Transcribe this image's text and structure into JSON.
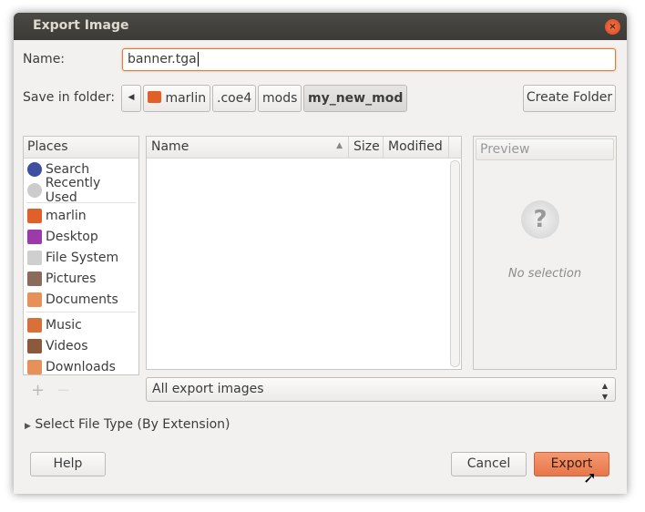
{
  "window": {
    "title": "Export Image"
  },
  "name_label": "Name:",
  "name_value": "banner.tga",
  "folder_label": "Save in folder:",
  "breadcrumbs": [
    "marlin",
    ".coe4",
    "mods",
    "my_new_mod"
  ],
  "create_folder": "Create Folder",
  "places": {
    "header": "Places",
    "items": [
      {
        "label": "Search",
        "color": "#3c4fa0"
      },
      {
        "label": "Recently Used",
        "color": "#bbbbbb"
      },
      {
        "label": "marlin",
        "color": "#e0602a"
      },
      {
        "label": "Desktop",
        "color": "#9b3aa8"
      },
      {
        "label": "File System",
        "color": "#cfcfcf"
      },
      {
        "label": "Pictures",
        "color": "#8a6a5a"
      },
      {
        "label": "Documents",
        "color": "#e6905a"
      },
      {
        "label": "Music",
        "color": "#d9703a"
      },
      {
        "label": "Videos",
        "color": "#8a5a3a"
      },
      {
        "label": "Downloads",
        "color": "#e6905a"
      }
    ]
  },
  "columns": {
    "name": "Name",
    "size": "Size",
    "modified": "Modified"
  },
  "preview": {
    "header": "Preview",
    "empty": "No selection"
  },
  "filter": "All export images",
  "file_type": "Select File Type (By Extension)",
  "buttons": {
    "help": "Help",
    "cancel": "Cancel",
    "export": "Export"
  }
}
